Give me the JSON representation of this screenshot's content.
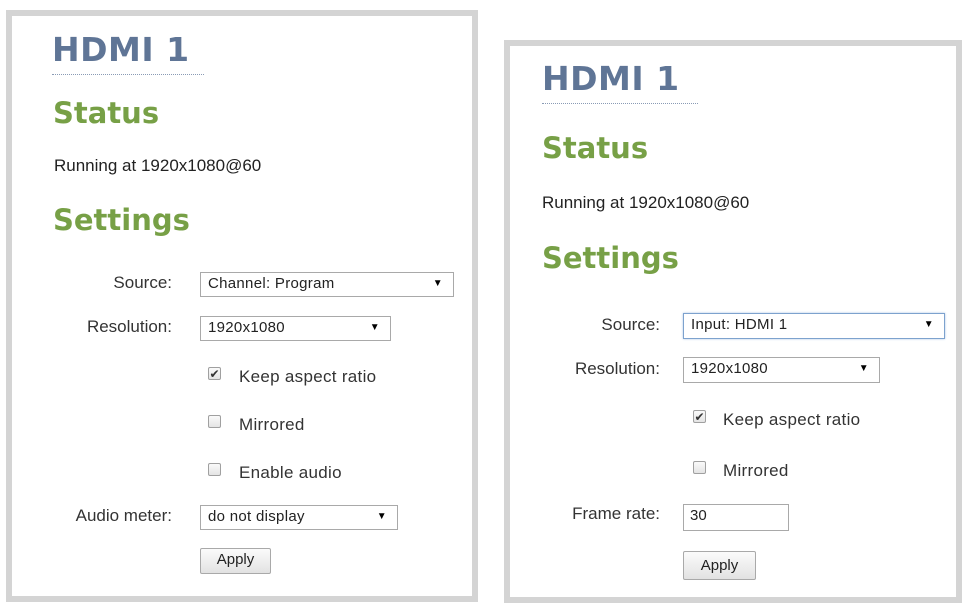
{
  "left": {
    "title": "HDMI 1",
    "status_heading": "Status",
    "status_text": "Running at 1920x1080@60",
    "settings_heading": "Settings",
    "source_label": "Source:",
    "source_value": "Channel: Program",
    "resolution_label": "Resolution:",
    "resolution_value": "1920x1080",
    "keep_aspect_label": "Keep aspect ratio",
    "keep_aspect_checked": true,
    "mirrored_label": "Mirrored",
    "mirrored_checked": false,
    "enable_audio_label": "Enable audio",
    "enable_audio_checked": false,
    "audio_meter_label": "Audio meter:",
    "audio_meter_value": "do not display",
    "apply_label": "Apply"
  },
  "right": {
    "title": "HDMI 1",
    "status_heading": "Status",
    "status_text": "Running at 1920x1080@60",
    "settings_heading": "Settings",
    "source_label": "Source:",
    "source_value": "Input: HDMI 1",
    "resolution_label": "Resolution:",
    "resolution_value": "1920x1080",
    "keep_aspect_label": "Keep aspect ratio",
    "keep_aspect_checked": true,
    "mirrored_label": "Mirrored",
    "mirrored_checked": false,
    "frame_rate_label": "Frame rate:",
    "frame_rate_value": "30",
    "apply_label": "Apply"
  },
  "icons": {
    "dropdown": "triangle-down",
    "check": "checkmark"
  },
  "colors": {
    "title": "#5f7596",
    "heading": "#77a046",
    "panel_border": "#d4d4d4",
    "focus_border": "#7da2ce"
  }
}
